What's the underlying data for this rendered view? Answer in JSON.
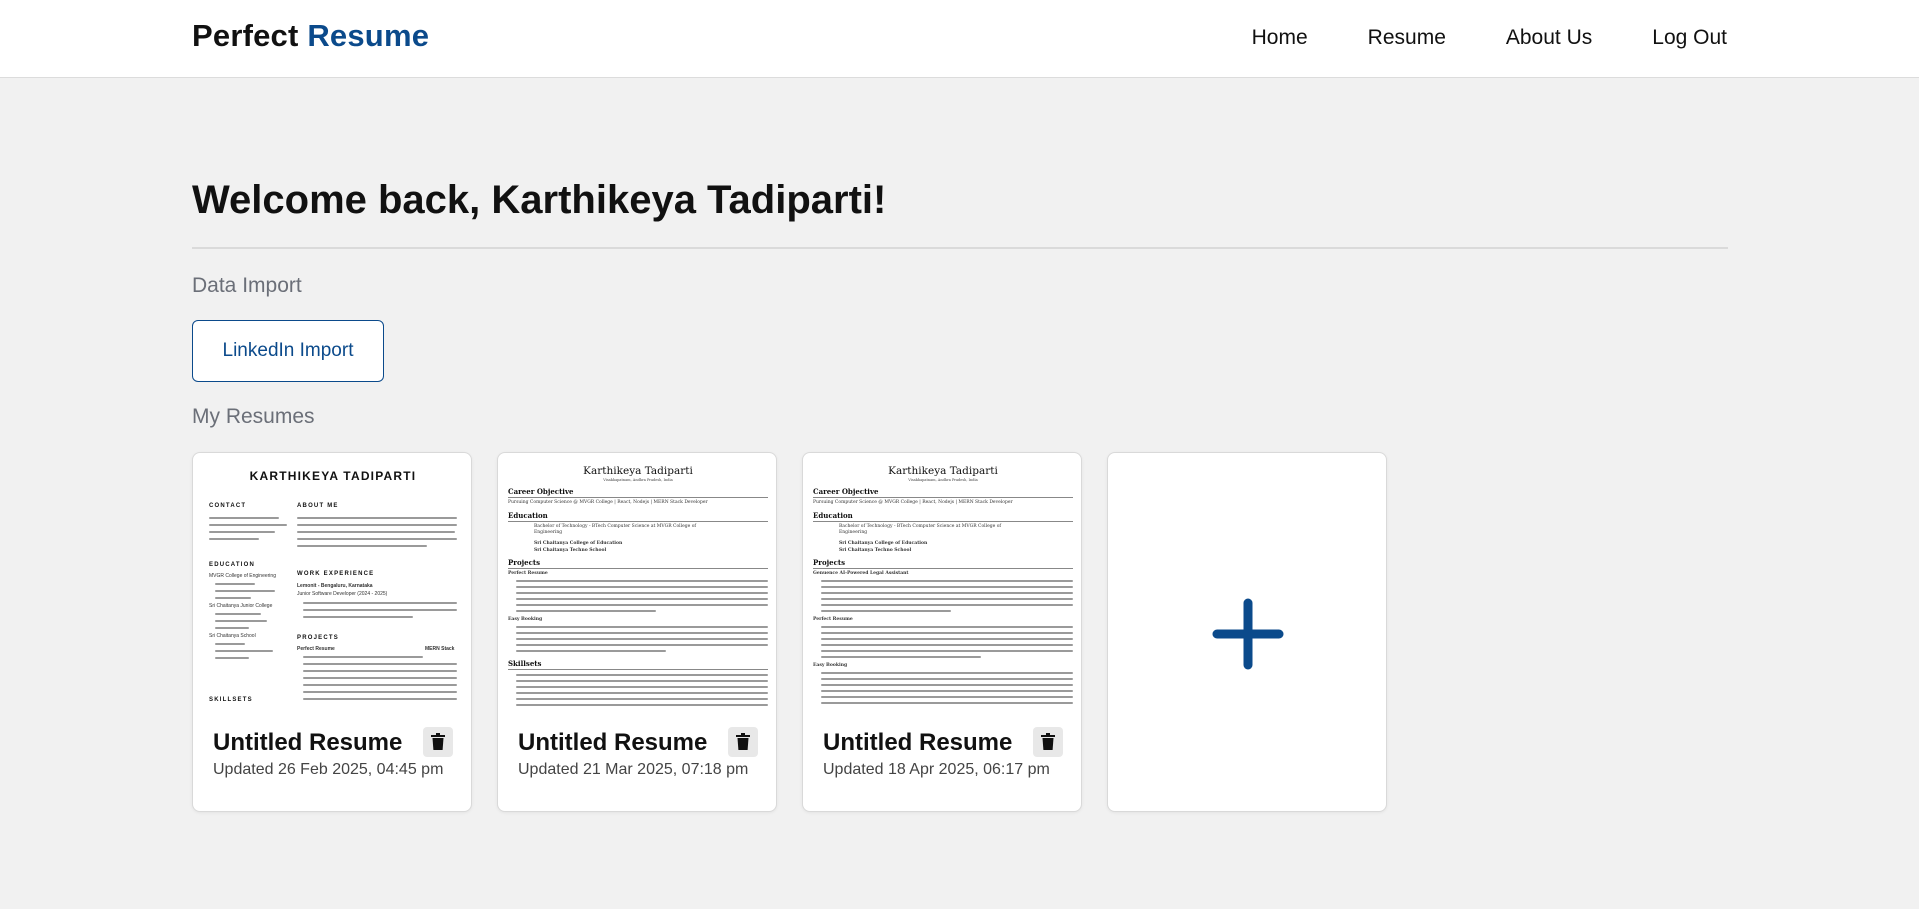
{
  "brand": {
    "part1": "Perfect",
    "part2": "Resume"
  },
  "nav": {
    "home": "Home",
    "resume": "Resume",
    "about": "About Us",
    "logout": "Log Out"
  },
  "welcome": "Welcome back, Karthikeya Tadiparti!",
  "data_import": {
    "title": "Data Import",
    "linkedin_button": "LinkedIn Import"
  },
  "my_resumes": {
    "title": "My Resumes",
    "cards": [
      {
        "title": "Untitled Resume",
        "updated": "Updated 26 Feb 2025, 04:45 pm"
      },
      {
        "title": "Untitled Resume",
        "updated": "Updated 21 Mar 2025, 07:18 pm"
      },
      {
        "title": "Untitled Resume",
        "updated": "Updated 18 Apr 2025, 06:17 pm"
      }
    ],
    "add_icon": "plus-icon"
  },
  "preview_modern": {
    "name": "KARTHIKEYA TADIPARTI",
    "contact_h": "CONTACT",
    "about_h": "ABOUT ME",
    "education_h": "EDUCATION",
    "work_h": "WORK EXPERIENCE",
    "projects_h": "PROJECTS",
    "skills_h": "SKILLSETS",
    "edu1": "MVGR College of Engineering",
    "edu2": "Sri Chaitanya Junior College",
    "edu3": "Sri Chaitanya School",
    "work1": "Lemonit - Bengaluru, Karnataka",
    "work1_role": "Junior Software Developer (2024 - 2025)",
    "proj1": "Perfect Resume",
    "proj1_tag": "MERN Stack"
  },
  "preview_classic": {
    "name": "Karthikeya Tadiparti",
    "sub": "Visakhapatnam, Andhra Pradesh, India",
    "career_h": "Career Objective",
    "career_t": "Pursuing Computer Science @ MVGR College | React, Nodejs | MERN Stack Developer",
    "education_h": "Education",
    "edu1": "Bachelor of Technology - BTech Computer Science at MVGR College of Engineering",
    "edu2": "Sri Chaitanya College of Education",
    "edu3": "Sri Chaitanya Techno School",
    "projects_h": "Projects",
    "proj_a": "Perfect Resume",
    "proj_b": "Easy Booking",
    "proj_c": "Genuence AI-Powered Legal Assistant",
    "skills_h": "Skillsets"
  },
  "colors": {
    "brand_blue": "#0b4a8b",
    "background": "#f1f1f1"
  },
  "icons": {
    "delete": "trash-icon",
    "add": "plus-icon"
  }
}
